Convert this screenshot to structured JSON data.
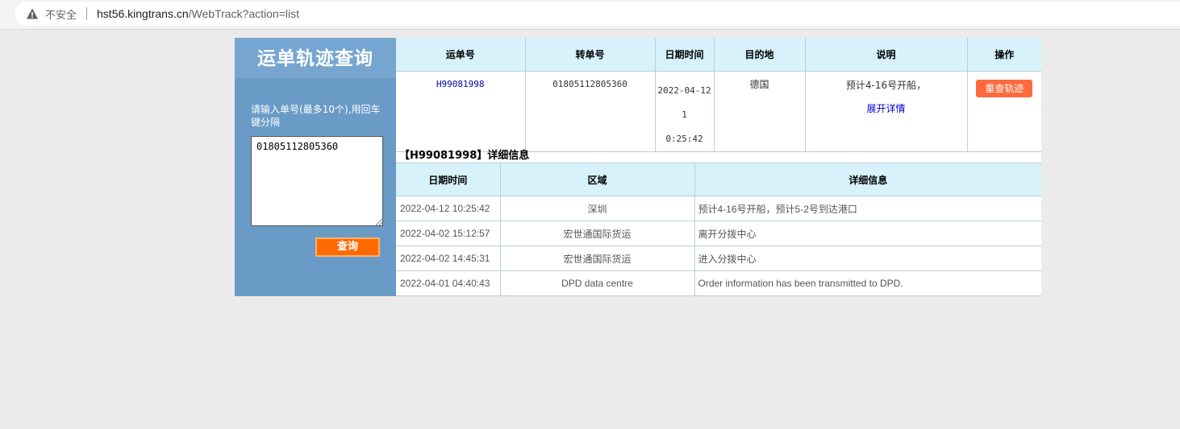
{
  "browser": {
    "security_label": "不安全",
    "url_host": "hst56.kingtrans.cn",
    "url_path": "/WebTrack?action=list"
  },
  "sidebar": {
    "title": "运单轨迹查询",
    "hint": "请输入单号(最多10个),用回车键分隔",
    "input_value": "01805112805360",
    "query_button": "查询"
  },
  "summary_table": {
    "headers": [
      "运单号",
      "转单号",
      "日期时间",
      "目的地",
      "说明",
      "操作"
    ],
    "row": {
      "waybill_no": "H99081998",
      "transfer_no": "01805112805360",
      "datetime": "2022-04-12 1\n0:25:42",
      "destination": "德国",
      "description": "预计4-16号开船，",
      "expand_link": "展开详情",
      "action_button": "重查轨迹"
    }
  },
  "detail": {
    "heading": "【H99081998】详细信息",
    "headers": [
      "日期时间",
      "区域",
      "详细信息"
    ],
    "rows": [
      {
        "time": "2022-04-12 10:25:42",
        "area": "深圳",
        "info": "预计4-16号开船，预计5-2号到达港口"
      },
      {
        "time": "2022-04-02 15:12:57",
        "area": "宏世通国际货运",
        "info": "离开分拨中心"
      },
      {
        "time": "2022-04-02 14:45:31",
        "area": "宏世通国际货运",
        "info": "进入分拨中心"
      },
      {
        "time": "2022-04-01 04:40:43",
        "area": "DPD data centre",
        "info": "Order information has been transmitted to DPD."
      }
    ]
  },
  "colors": {
    "sidebar_bg": "#6a9bc6",
    "header_bg": "#d7f2fb",
    "accent_orange": "#ff6a00"
  }
}
